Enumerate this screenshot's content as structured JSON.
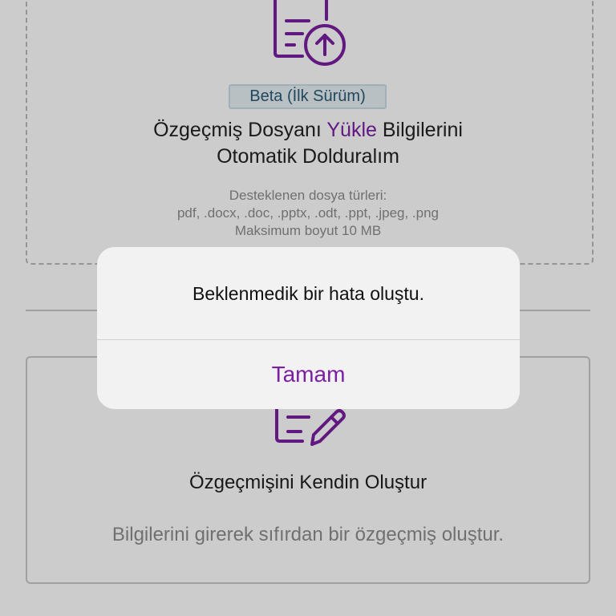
{
  "upload_card": {
    "badge": "Beta (İlk Sürüm)",
    "title_part1": "Özgeçmiş Dosyanı ",
    "title_accent": "Yükle",
    "title_part2": " Bilgilerini",
    "title_line2": "Otomatik Dolduralım",
    "supported_label": "Desteklenen dosya türleri:",
    "supported_types": "pdf, .docx, .doc, .pptx, .odt, .ppt, .jpeg, .png",
    "max_size": "Maksimum boyut 10 MB",
    "icon": "document-upload-icon"
  },
  "create_card": {
    "title": "Özgeçmişini Kendin Oluştur",
    "description": "Bilgilerini girerek sıfırdan bir özgeçmiş oluştur.",
    "icon": "document-edit-icon"
  },
  "alert": {
    "message": "Beklenmedik bir hata oluştu.",
    "ok_label": "Tamam"
  },
  "colors": {
    "accent": "#7b1fa2",
    "overlay": "rgba(0,0,0,0.20)",
    "alert_bg": "#f2f2f2"
  }
}
